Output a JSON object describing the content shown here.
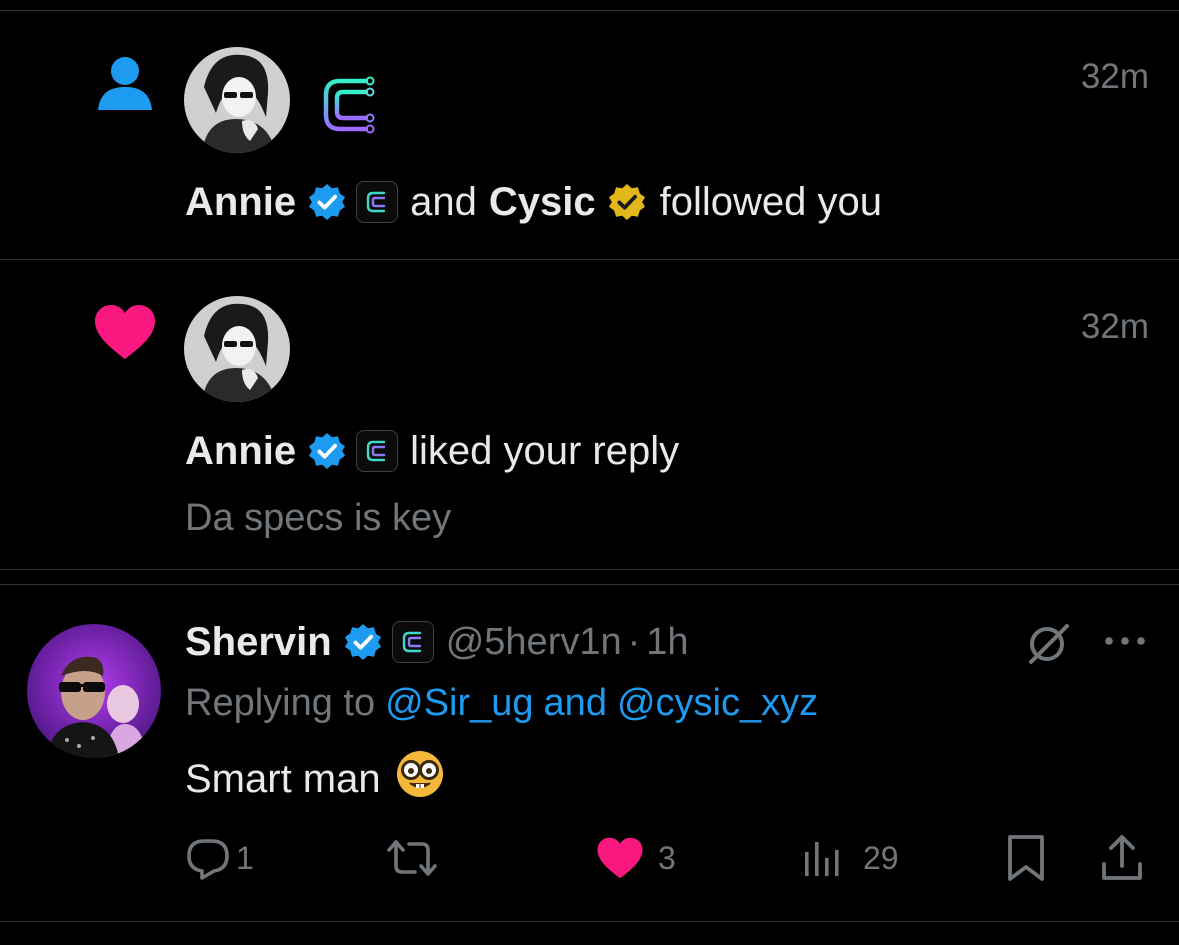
{
  "notifications": [
    {
      "type": "follow",
      "icon": "person-icon",
      "time": "32m",
      "user1": "Annie",
      "connector": "and",
      "user2": "Cysic",
      "action": "followed you"
    },
    {
      "type": "like",
      "icon": "heart-icon",
      "time": "32m",
      "user": "Annie",
      "action": "liked your reply",
      "preview": "Da specs is key"
    }
  ],
  "reply": {
    "name": "Shervin",
    "handle": "@5herv1n",
    "separator": "·",
    "time": "1h",
    "replying_prefix": "Replying to",
    "replying_user1": "@Sir_ug",
    "replying_connector": "and",
    "replying_user2": "@cysic_xyz",
    "text": "Smart man",
    "emoji": "🤓",
    "stats": {
      "replies": "1",
      "likes": "3",
      "views": "29"
    }
  },
  "colors": {
    "background": "#000000",
    "text": "#e7e9ea",
    "muted": "#71767b",
    "link_blue": "#1d9bf0",
    "like_pink": "#f91880",
    "verified_blue": "#1d9bf0",
    "verified_gold": "#e2b719",
    "divider": "#2f3336"
  }
}
